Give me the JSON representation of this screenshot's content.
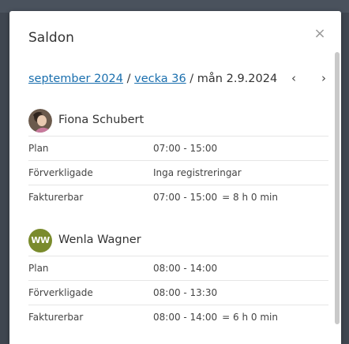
{
  "dialog": {
    "title": "Saldon",
    "close_symbol": "×"
  },
  "date_nav": {
    "month": "september 2024",
    "separator1": " / ",
    "week": "vecka 36",
    "separator2": " / ",
    "day": "mån 2.9.2024",
    "prev_symbol": "‹",
    "next_symbol": "›"
  },
  "people": [
    {
      "name": "Fiona Schubert",
      "avatar_type": "photo",
      "rows": [
        {
          "label": "Plan",
          "value": "07:00 - 15:00",
          "total": ""
        },
        {
          "label": "Förverkligade",
          "value": "Inga registreringar",
          "total": ""
        },
        {
          "label": "Fakturerbar",
          "value": "07:00 - 15:00",
          "total": "= 8 h 0 min"
        }
      ]
    },
    {
      "name": "Wenla Wagner",
      "avatar_type": "initials",
      "initials": "WW",
      "avatar_color": "#7a8b2c",
      "rows": [
        {
          "label": "Plan",
          "value": "08:00 - 14:00",
          "total": ""
        },
        {
          "label": "Förverkligade",
          "value": "08:00 - 13:30",
          "total": ""
        },
        {
          "label": "Fakturerbar",
          "value": "08:00 - 14:00",
          "total": "= 6 h 0 min"
        }
      ]
    }
  ],
  "colors": {
    "link": "#1a6fae",
    "text": "#333333",
    "divider": "#e6e6e6"
  }
}
